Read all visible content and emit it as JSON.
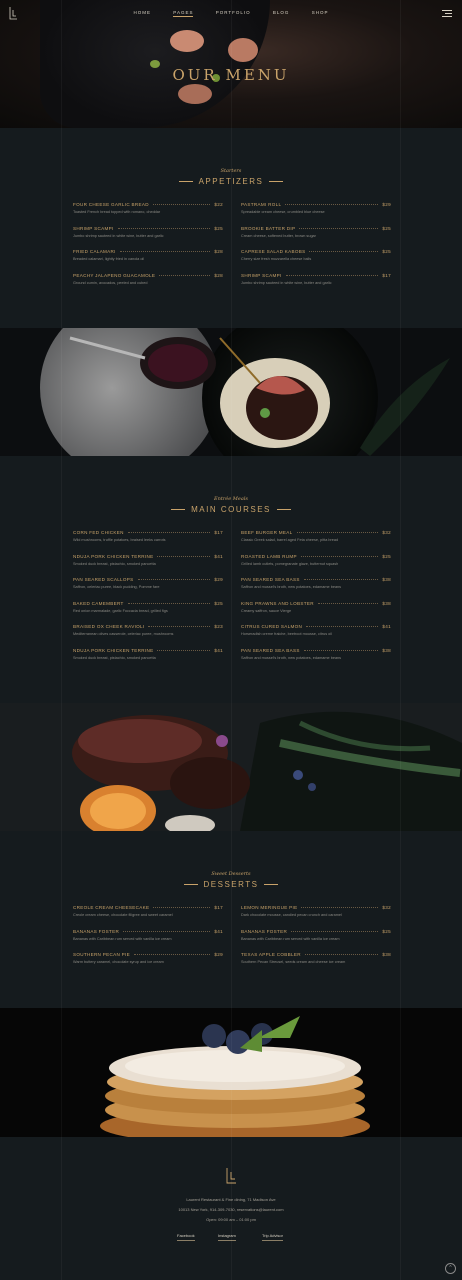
{
  "nav": {
    "items": [
      "HOME",
      "PAGES",
      "PORTFOLIO",
      "BLOG",
      "SHOP"
    ],
    "active": "PAGES"
  },
  "hero": {
    "title": "OUR MENU"
  },
  "appetizers": {
    "subtitle": "Starters",
    "title": "APPETIZERS",
    "left": [
      {
        "name": "FOUR CHEESE GARLIC BREAD",
        "price": "$22",
        "desc": "Toasted French bread topped with romano, cheddar"
      },
      {
        "name": "SHRIMP SCAMPI",
        "price": "$25",
        "desc": "Jumbo shrimp sauteed in white wine, butter and garlic"
      },
      {
        "name": "FRIED CALAMARI",
        "price": "$28",
        "desc": "Breaded calamari, lightly fried in canola oil"
      },
      {
        "name": "PEACHY JALAPENO GUACAMOLE",
        "price": "$28",
        "desc": "Ground cumin, avocados, peeled and cubed"
      }
    ],
    "right": [
      {
        "name": "PASTRAMI ROLL",
        "price": "$29",
        "desc": "Spreadable cream cheese, crumbled blue cheese"
      },
      {
        "name": "BROOKIE BATTER DIP",
        "price": "$25",
        "desc": "Cream cheese, softened butter, brown sugar"
      },
      {
        "name": "CAPRESE SALAD KABOBS",
        "price": "$25",
        "desc": "Cherry size fresh mozzarella cheese balls"
      },
      {
        "name": "SHRIMP SCAMPI",
        "price": "$17",
        "desc": "Jumbo shrimp sauteed in white wine, butter and garlic"
      }
    ]
  },
  "main": {
    "subtitle": "Entrée Meals",
    "title": "MAIN COURSES",
    "left": [
      {
        "name": "CORN FED CHICKEN",
        "price": "$17",
        "desc": "Wild mushrooms, truffle potatoes, braised leeks carrots"
      },
      {
        "name": "NDUJA PORK CHICKEN TERRINE",
        "price": "$41",
        "desc": "Smoked duck breast, pistachio, smoked pancetta"
      },
      {
        "name": "PAN SEARED SCALLOPS",
        "price": "$29",
        "desc": "Saffron, celeriac puree, black pudding, Pomme fare"
      },
      {
        "name": "BAKED CAMEMBERT",
        "price": "$25",
        "desc": "Red onion marmalade, garlic Foccacia bread, grilled figs"
      },
      {
        "name": "BRAISED OX CHEEK RAVIOLI",
        "price": "$23",
        "desc": "Mediterranean olives casserole, celeriac puree, mushrooms"
      },
      {
        "name": "NDUJA PORK CHICKEN TERRINE",
        "price": "$41",
        "desc": "Smoked duck breast, pistachio, smoked pancetta"
      }
    ],
    "right": [
      {
        "name": "BEEF BURGER MEAL",
        "price": "$32",
        "desc": "Classic Greek salad, barrel aged Feta cheese, pitta bread"
      },
      {
        "name": "ROASTED LAMB RUMP",
        "price": "$25",
        "desc": "Grilled lamb cutlets, pomegranate glaze, butternut squash"
      },
      {
        "name": "PAN SEARED SEA BASS",
        "price": "$38",
        "desc": "Saffron and mussel's broth, new potatoes, edamame beans"
      },
      {
        "name": "KING PRAWNS AND LOBSTER",
        "price": "$38",
        "desc": "Creamy saffron, sauce Vierge"
      },
      {
        "name": "CITRUS CURED SALMON",
        "price": "$41",
        "desc": "Horseradish creme fraiche, beetroot mousse, citrus oil"
      },
      {
        "name": "PAN SEARED SEA BASS",
        "price": "$38",
        "desc": "Saffron and mussel's broth, new potatoes, edamame beans"
      }
    ]
  },
  "desserts": {
    "subtitle": "Sweet Desserts",
    "title": "DESSERTS",
    "left": [
      {
        "name": "CREOLE CREAM CHEESECAKE",
        "price": "$17",
        "desc": "Creole cream cheese, chocolate filigree and sweet caramel"
      },
      {
        "name": "BANANAS FOSTER",
        "price": "$41",
        "desc": "Bananas with Caribbean rum served with vanilla ice cream"
      },
      {
        "name": "SOUTHERN PECAN PIE",
        "price": "$29",
        "desc": "Warm buttery caramel, chocolate syrup and ice cream"
      }
    ],
    "right": [
      {
        "name": "LEMON MERINGUE PIE",
        "price": "$32",
        "desc": "Dark chocolate mousse, candied pecan crunch and caramel"
      },
      {
        "name": "BANANAS FOSTER",
        "price": "$25",
        "desc": "Bananas with Caribbean rum served with vanilla ice cream"
      },
      {
        "name": "TEXAS APPLE COBBLER",
        "price": "$38",
        "desc": "Southern Pecan Streusel, seeds cream and cheese ice cream"
      }
    ]
  },
  "footer": {
    "line1": "Laurent Restaurant & Fine dining, 71 Madison Ave",
    "line2": "10013 New York, 914-309-7030, reservations@laurent.com",
    "line3": "Open: 09:00 am – 01:00 pm",
    "social": [
      "Facebook",
      "Instagram",
      "Trip Advisor"
    ]
  },
  "colors": {
    "accent": "#c9a36a",
    "background": "#151b1e"
  }
}
